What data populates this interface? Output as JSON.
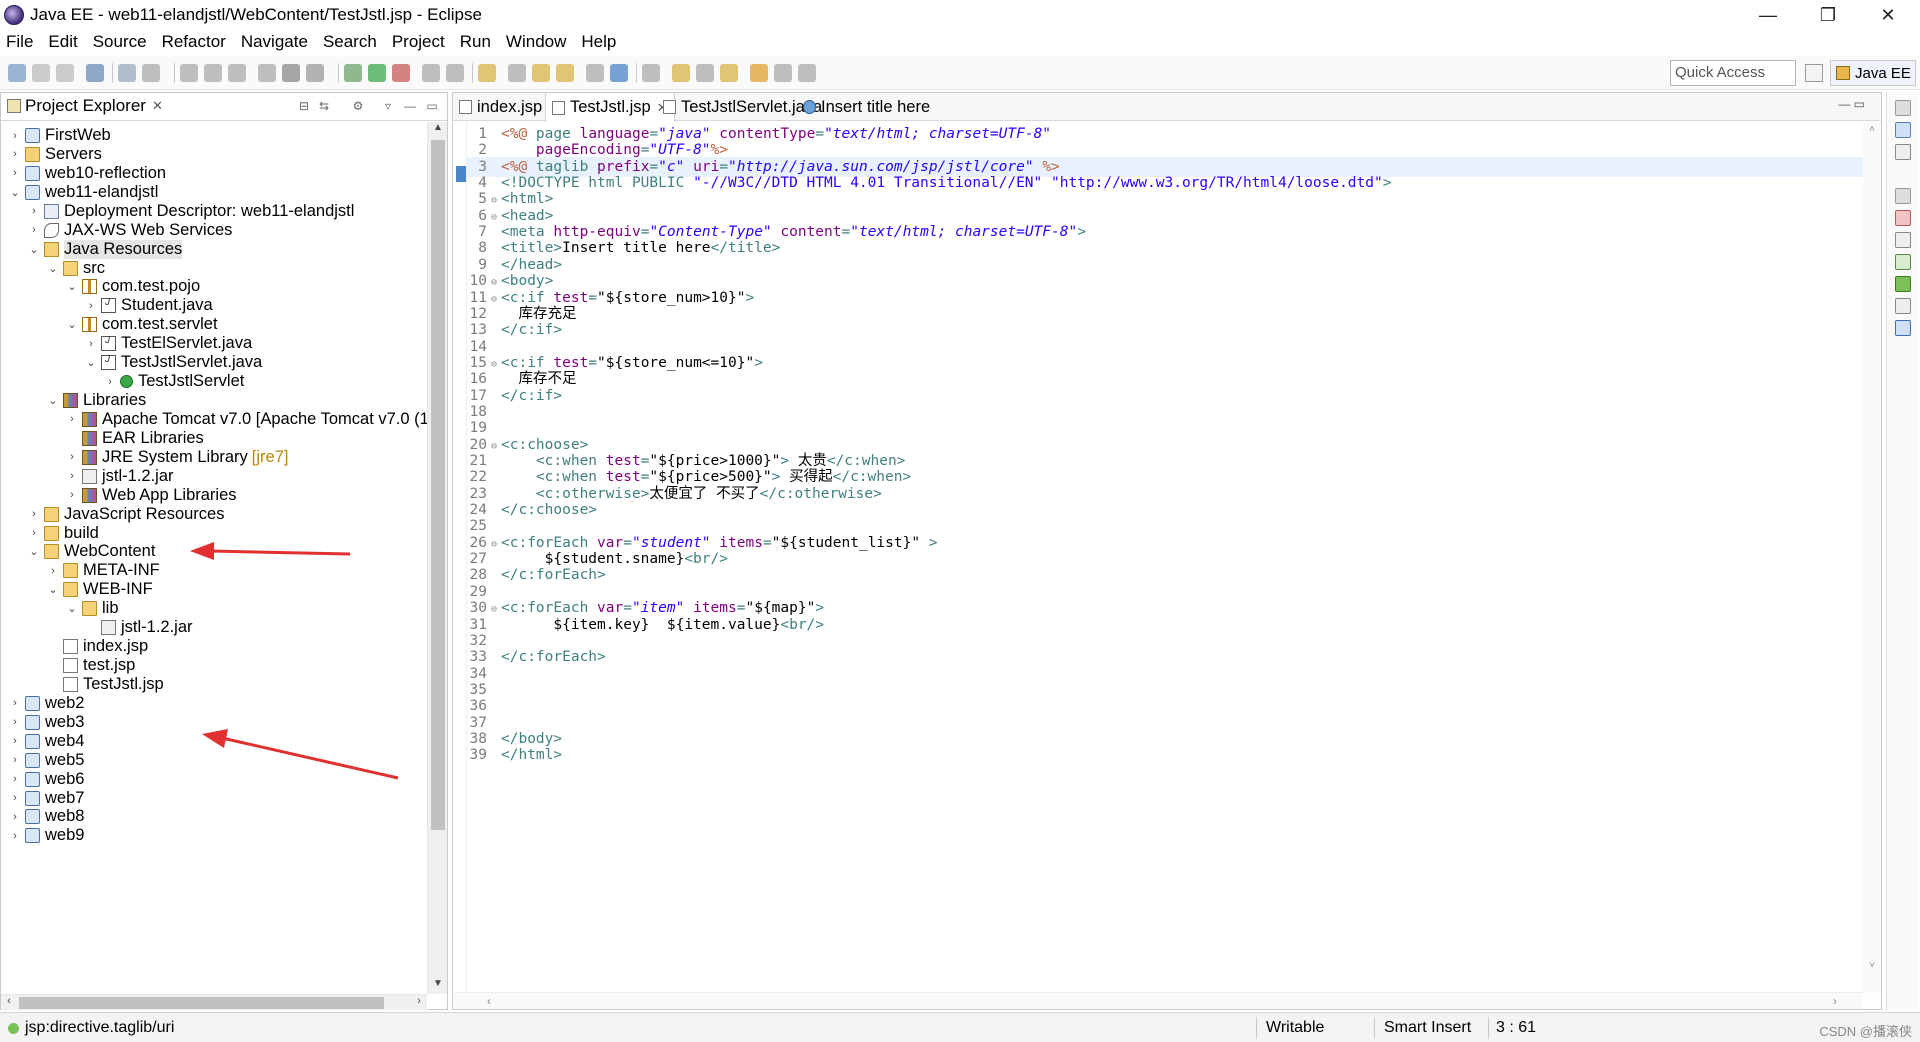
{
  "window": {
    "title": "Java EE - web11-elandjstl/WebContent/TestJstl.jsp - Eclipse",
    "minimize": "—",
    "maximize": "❐",
    "close": "✕"
  },
  "menu": [
    "File",
    "Edit",
    "Source",
    "Refactor",
    "Navigate",
    "Search",
    "Project",
    "Run",
    "Window",
    "Help"
  ],
  "toolbar": {
    "quick_access": "Quick Access",
    "perspective": "Java EE"
  },
  "explorer": {
    "title": "Project Explorer",
    "close": "✕",
    "tree": [
      {
        "label": "FirstWeb",
        "depth": 0,
        "chev": "›",
        "icon": "proj"
      },
      {
        "label": "Servers",
        "depth": 0,
        "chev": "›",
        "icon": "folder"
      },
      {
        "label": "web10-reflection",
        "depth": 0,
        "chev": "›",
        "icon": "proj"
      },
      {
        "label": "web11-elandjstl",
        "depth": 0,
        "chev": "⌄",
        "icon": "proj"
      },
      {
        "label": "Deployment Descriptor: web11-elandjstl",
        "depth": 1,
        "chev": "›",
        "icon": "deploy"
      },
      {
        "label": "JAX-WS Web Services",
        "depth": 1,
        "chev": "›",
        "icon": "ws"
      },
      {
        "label": "Java Resources",
        "depth": 1,
        "chev": "⌄",
        "icon": "jsr",
        "selected": true
      },
      {
        "label": "src",
        "depth": 2,
        "chev": "⌄",
        "icon": "folder"
      },
      {
        "label": "com.test.pojo",
        "depth": 3,
        "chev": "⌄",
        "icon": "pkg"
      },
      {
        "label": "Student.java",
        "depth": 4,
        "chev": "›",
        "icon": "java"
      },
      {
        "label": "com.test.servlet",
        "depth": 3,
        "chev": "⌄",
        "icon": "pkg"
      },
      {
        "label": "TestElServlet.java",
        "depth": 4,
        "chev": "›",
        "icon": "java"
      },
      {
        "label": "TestJstlServlet.java",
        "depth": 4,
        "chev": "⌄",
        "icon": "java"
      },
      {
        "label": "TestJstlServlet",
        "depth": 5,
        "chev": "›",
        "icon": "cls"
      },
      {
        "label": "Libraries",
        "depth": 2,
        "chev": "⌄",
        "icon": "lib"
      },
      {
        "label": "Apache Tomcat v7.0 [Apache Tomcat v7.0 (1",
        "depth": 3,
        "chev": "›",
        "icon": "lib"
      },
      {
        "label": "EAR Libraries",
        "depth": 3,
        "chev": "",
        "icon": "lib"
      },
      {
        "label": "JRE System Library",
        "deco": "[jre7]",
        "depth": 3,
        "chev": "›",
        "icon": "lib"
      },
      {
        "label": "jstl-1.2.jar",
        "depth": 3,
        "chev": "›",
        "icon": "jar"
      },
      {
        "label": "Web App Libraries",
        "depth": 3,
        "chev": "›",
        "icon": "lib"
      },
      {
        "label": "JavaScript Resources",
        "depth": 1,
        "chev": "›",
        "icon": "jsr"
      },
      {
        "label": "build",
        "depth": 1,
        "chev": "›",
        "icon": "folder"
      },
      {
        "label": "WebContent",
        "depth": 1,
        "chev": "⌄",
        "icon": "folder"
      },
      {
        "label": "META-INF",
        "depth": 2,
        "chev": "›",
        "icon": "folder"
      },
      {
        "label": "WEB-INF",
        "depth": 2,
        "chev": "⌄",
        "icon": "folder"
      },
      {
        "label": "lib",
        "depth": 3,
        "chev": "⌄",
        "icon": "folder"
      },
      {
        "label": "jstl-1.2.jar",
        "depth": 4,
        "chev": "",
        "icon": "jar"
      },
      {
        "label": "index.jsp",
        "depth": 2,
        "chev": "",
        "icon": "jsp"
      },
      {
        "label": "test.jsp",
        "depth": 2,
        "chev": "",
        "icon": "jsp"
      },
      {
        "label": "TestJstl.jsp",
        "depth": 2,
        "chev": "",
        "icon": "jsp"
      },
      {
        "label": "web2",
        "depth": 0,
        "chev": "›",
        "icon": "proj"
      },
      {
        "label": "web3",
        "depth": 0,
        "chev": "›",
        "icon": "proj"
      },
      {
        "label": "web4",
        "depth": 0,
        "chev": "›",
        "icon": "proj"
      },
      {
        "label": "web5",
        "depth": 0,
        "chev": "›",
        "icon": "proj"
      },
      {
        "label": "web6",
        "depth": 0,
        "chev": "›",
        "icon": "proj"
      },
      {
        "label": "web7",
        "depth": 0,
        "chev": "›",
        "icon": "proj"
      },
      {
        "label": "web8",
        "depth": 0,
        "chev": "›",
        "icon": "proj"
      },
      {
        "label": "web9",
        "depth": 0,
        "chev": "›",
        "icon": "proj"
      }
    ]
  },
  "editor": {
    "tabs": [
      {
        "label": "index.jsp",
        "icon": "file",
        "active": false
      },
      {
        "label": "TestJstl.jsp",
        "icon": "file",
        "active": true,
        "close": "✕"
      },
      {
        "label": "TestJstlServlet.java",
        "icon": "file",
        "active": false
      },
      {
        "label": "Insert title here",
        "icon": "globe",
        "active": false
      }
    ],
    "current_line": 3,
    "lines": [
      {
        "n": "1",
        "fold": "",
        "src": [
          [
            "d",
            "<%@"
          ],
          [
            "t",
            " page "
          ],
          [
            "a",
            "language"
          ],
          [
            "t",
            "="
          ],
          [
            "s",
            "\"java\""
          ],
          [
            "t",
            " "
          ],
          [
            "a",
            "contentType"
          ],
          [
            "t",
            "="
          ],
          [
            "s",
            "\"text/html; charset=UTF-8\""
          ]
        ]
      },
      {
        "n": "2",
        "fold": "",
        "src": [
          [
            "t",
            "    "
          ],
          [
            "a",
            "pageEncoding"
          ],
          [
            "t",
            "="
          ],
          [
            "s",
            "\"UTF-8\""
          ],
          [
            "d",
            "%>"
          ]
        ]
      },
      {
        "n": "3",
        "fold": "",
        "src": [
          [
            "d",
            "<%@"
          ],
          [
            "t",
            " taglib "
          ],
          [
            "a",
            "prefix"
          ],
          [
            "t",
            "="
          ],
          [
            "s",
            "\"c\""
          ],
          [
            "t",
            " "
          ],
          [
            "a",
            "uri"
          ],
          [
            "t",
            "="
          ],
          [
            "s",
            "\"http://java.sun.com/jsp/jstl/core\""
          ],
          [
            "t",
            " "
          ],
          [
            "d",
            "%>"
          ]
        ]
      },
      {
        "n": "4",
        "fold": "",
        "src": [
          [
            "t",
            "<!DOCTYPE html PUBLIC "
          ],
          [
            "q",
            "\"-//W3C//DTD HTML 4.01 Transitional//EN\""
          ],
          [
            "t",
            " "
          ],
          [
            "q",
            "\"http://www.w3.org/TR/html4/loose.dtd\""
          ],
          [
            "t",
            ">"
          ]
        ]
      },
      {
        "n": "5",
        "fold": "⊖",
        "src": [
          [
            "t",
            "<html>"
          ]
        ]
      },
      {
        "n": "6",
        "fold": "⊖",
        "src": [
          [
            "t",
            "<head>"
          ]
        ]
      },
      {
        "n": "7",
        "fold": "",
        "src": [
          [
            "t",
            "<meta "
          ],
          [
            "a",
            "http-equiv"
          ],
          [
            "t",
            "="
          ],
          [
            "s",
            "\"Content-Type\""
          ],
          [
            "t",
            " "
          ],
          [
            "a",
            "content"
          ],
          [
            "t",
            "="
          ],
          [
            "s",
            "\"text/html; charset=UTF-8\""
          ],
          [
            "t",
            ">"
          ]
        ]
      },
      {
        "n": "8",
        "fold": "",
        "src": [
          [
            "t",
            "<title>"
          ],
          [
            "x",
            "Insert title here"
          ],
          [
            "t",
            "</title>"
          ]
        ]
      },
      {
        "n": "9",
        "fold": "",
        "src": [
          [
            "t",
            "</head>"
          ]
        ]
      },
      {
        "n": "10",
        "fold": "⊖",
        "src": [
          [
            "t",
            "<body>"
          ]
        ]
      },
      {
        "n": "11",
        "fold": "⊖",
        "src": [
          [
            "t",
            "<c:if "
          ],
          [
            "a",
            "test"
          ],
          [
            "t",
            "="
          ],
          [
            "x",
            "\"${store_num>10}\""
          ],
          [
            "t",
            ">"
          ]
        ]
      },
      {
        "n": "12",
        "fold": "",
        "src": [
          [
            "x",
            "  库存充足"
          ]
        ]
      },
      {
        "n": "13",
        "fold": "",
        "src": [
          [
            "t",
            "</c:if>"
          ]
        ]
      },
      {
        "n": "14",
        "fold": "",
        "src": []
      },
      {
        "n": "15",
        "fold": "⊖",
        "src": [
          [
            "t",
            "<c:if "
          ],
          [
            "a",
            "test"
          ],
          [
            "t",
            "="
          ],
          [
            "x",
            "\"${store_num<=10}\""
          ],
          [
            "t",
            ">"
          ]
        ]
      },
      {
        "n": "16",
        "fold": "",
        "src": [
          [
            "x",
            "  库存不足"
          ]
        ]
      },
      {
        "n": "17",
        "fold": "",
        "src": [
          [
            "t",
            "</c:if>"
          ]
        ]
      },
      {
        "n": "18",
        "fold": "",
        "src": []
      },
      {
        "n": "19",
        "fold": "",
        "src": []
      },
      {
        "n": "20",
        "fold": "⊖",
        "src": [
          [
            "t",
            "<c:choose>"
          ]
        ]
      },
      {
        "n": "21",
        "fold": "",
        "src": [
          [
            "t",
            "    <c:when "
          ],
          [
            "a",
            "test"
          ],
          [
            "t",
            "="
          ],
          [
            "x",
            "\"${price>1000}\""
          ],
          [
            "t",
            ">"
          ],
          [
            "x",
            " 太贵"
          ],
          [
            "t",
            "</c:when>"
          ]
        ]
      },
      {
        "n": "22",
        "fold": "",
        "src": [
          [
            "t",
            "    <c:when "
          ],
          [
            "a",
            "test"
          ],
          [
            "t",
            "="
          ],
          [
            "x",
            "\"${price>500}\""
          ],
          [
            "t",
            ">"
          ],
          [
            "x",
            " 买得起"
          ],
          [
            "t",
            "</c:when>"
          ]
        ]
      },
      {
        "n": "23",
        "fold": "",
        "src": [
          [
            "t",
            "    <c:otherwise>"
          ],
          [
            "x",
            "太便宜了 不买了"
          ],
          [
            "t",
            "</c:otherwise>"
          ]
        ]
      },
      {
        "n": "24",
        "fold": "",
        "src": [
          [
            "t",
            "</c:choose>"
          ]
        ]
      },
      {
        "n": "25",
        "fold": "",
        "src": []
      },
      {
        "n": "26",
        "fold": "⊖",
        "src": [
          [
            "t",
            "<c:forEach "
          ],
          [
            "a",
            "var"
          ],
          [
            "t",
            "="
          ],
          [
            "s",
            "\"student\""
          ],
          [
            "t",
            " "
          ],
          [
            "a",
            "items"
          ],
          [
            "t",
            "="
          ],
          [
            "x",
            "\"${student_list}\""
          ],
          [
            "t",
            " >"
          ]
        ]
      },
      {
        "n": "27",
        "fold": "",
        "src": [
          [
            "x",
            "     ${student.sname}"
          ],
          [
            "t",
            "<br/>"
          ]
        ]
      },
      {
        "n": "28",
        "fold": "",
        "src": [
          [
            "t",
            "</c:forEach>"
          ]
        ]
      },
      {
        "n": "29",
        "fold": "",
        "src": []
      },
      {
        "n": "30",
        "fold": "⊖",
        "src": [
          [
            "t",
            "<c:forEach "
          ],
          [
            "a",
            "var"
          ],
          [
            "t",
            "="
          ],
          [
            "s",
            "\"item\""
          ],
          [
            "t",
            " "
          ],
          [
            "a",
            "items"
          ],
          [
            "t",
            "="
          ],
          [
            "x",
            "\"${map}\""
          ],
          [
            "t",
            ">"
          ]
        ]
      },
      {
        "n": "31",
        "fold": "",
        "src": [
          [
            "x",
            "      ${item.key}  ${item.value}"
          ],
          [
            "t",
            "<br/>"
          ]
        ]
      },
      {
        "n": "32",
        "fold": "",
        "src": []
      },
      {
        "n": "33",
        "fold": "",
        "src": [
          [
            "t",
            "</c:forEach>"
          ]
        ]
      },
      {
        "n": "34",
        "fold": "",
        "src": []
      },
      {
        "n": "35",
        "fold": "",
        "src": []
      },
      {
        "n": "36",
        "fold": "",
        "src": []
      },
      {
        "n": "37",
        "fold": "",
        "src": []
      },
      {
        "n": "38",
        "fold": "",
        "src": [
          [
            "t",
            "</body>"
          ]
        ]
      },
      {
        "n": "39",
        "fold": "",
        "src": [
          [
            "t",
            "</html>"
          ]
        ]
      }
    ]
  },
  "status": {
    "context": "jsp:directive.taglib/uri",
    "writable": "Writable",
    "insert_mode": "Smart Insert",
    "position": "3 : 61",
    "watermark": "CSDN @播滚侠"
  },
  "colors": {
    "tag": "#3f7f7f",
    "attribute": "#7f007f",
    "string": "#2a00ff",
    "directive": "#bf5f3f",
    "annotation_arrow": "#e03030",
    "current_line": "#e8f2fe"
  }
}
